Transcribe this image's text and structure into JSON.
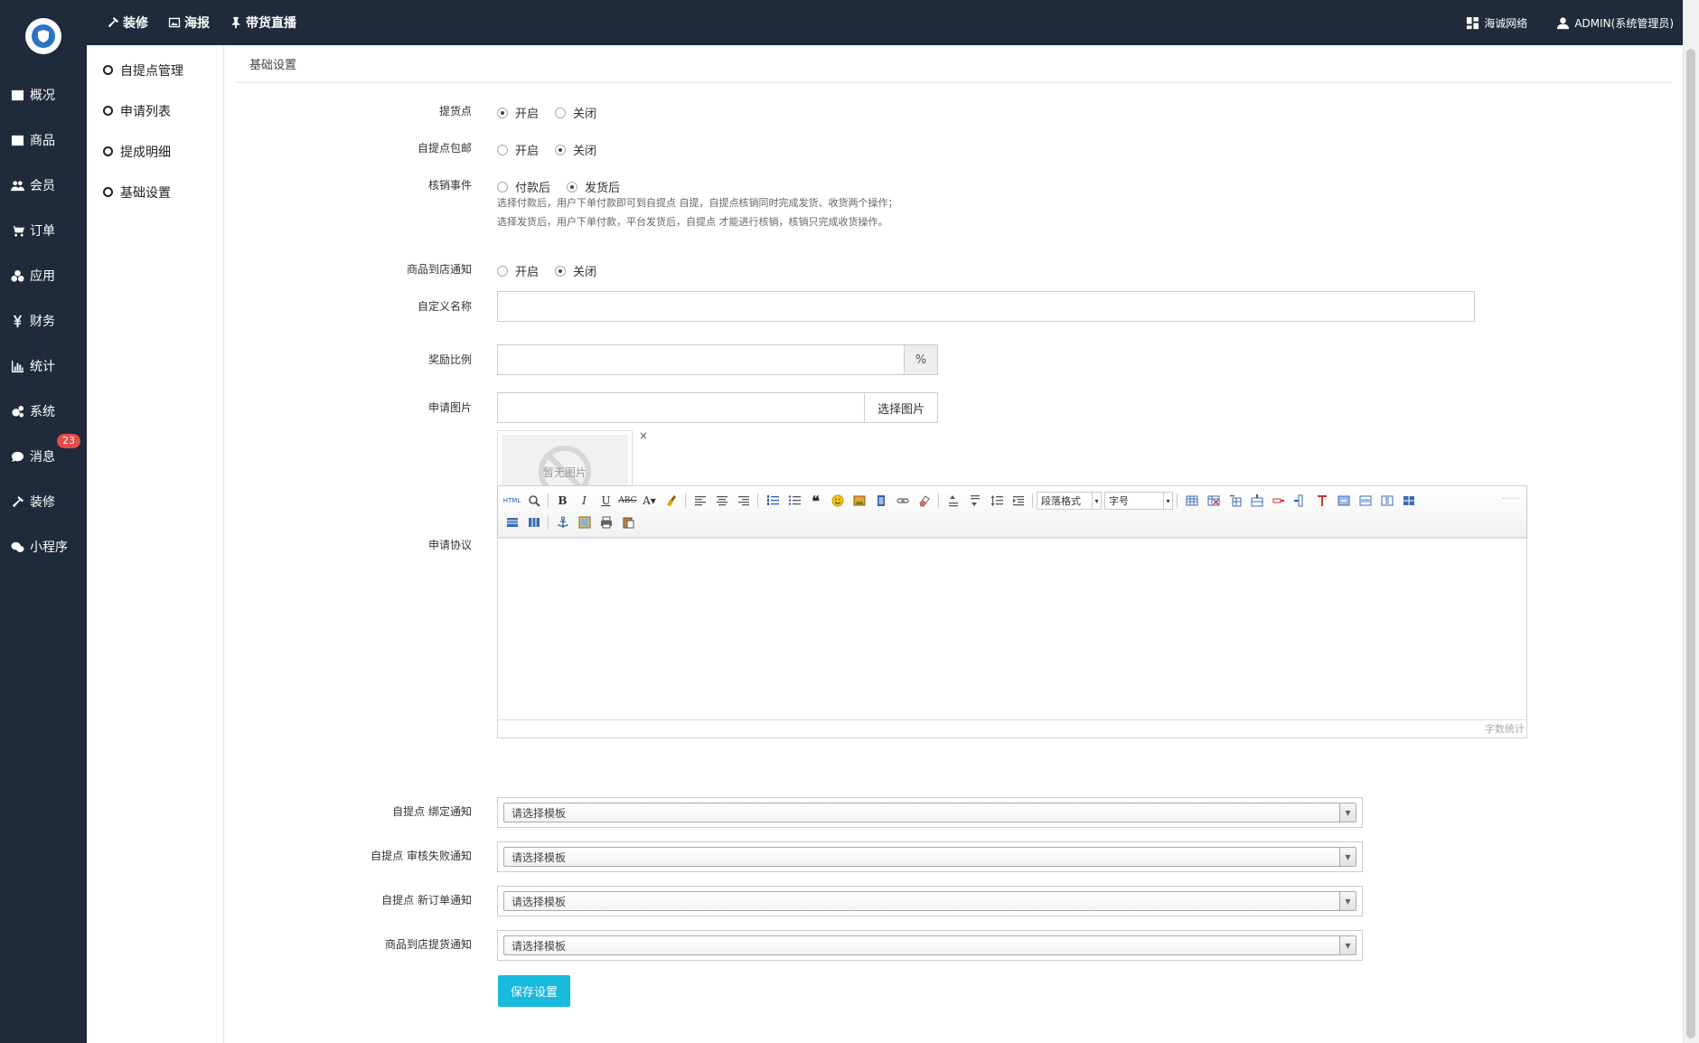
{
  "topnav": {
    "items": [
      {
        "label": "装修",
        "icon": "hammer-icon"
      },
      {
        "label": "海报",
        "icon": "image-icon"
      },
      {
        "label": "带货直播",
        "icon": "pin-icon"
      }
    ],
    "brand": "海诚网络",
    "user": "ADMIN(系统管理员)"
  },
  "sidebar": {
    "items": [
      {
        "label": "概况",
        "icon": "overview-icon"
      },
      {
        "label": "商品",
        "icon": "goods-icon"
      },
      {
        "label": "会员",
        "icon": "members-icon"
      },
      {
        "label": "订单",
        "icon": "cart-icon"
      },
      {
        "label": "应用",
        "icon": "apps-icon"
      },
      {
        "label": "财务",
        "icon": "yen-icon"
      },
      {
        "label": "统计",
        "icon": "chart-icon"
      },
      {
        "label": "系统",
        "icon": "gears-icon"
      },
      {
        "label": "消息",
        "icon": "chat-icon",
        "badge": "23"
      },
      {
        "label": "装修",
        "icon": "hammer-icon"
      },
      {
        "label": "小程序",
        "icon": "wechat-icon"
      }
    ]
  },
  "subnav": {
    "items": [
      "自提点管理",
      "申请列表",
      "提成明细",
      "基础设置"
    ]
  },
  "breadcrumb": "基础设置",
  "form": {
    "pickup": {
      "label": "提货点",
      "options": [
        "开启",
        "关闭"
      ],
      "selected": 0
    },
    "free_shipping": {
      "label": "自提点包邮",
      "options": [
        "开启",
        "关闭"
      ],
      "selected": 1
    },
    "verify_event": {
      "label": "核销事件",
      "options": [
        "付款后",
        "发货后"
      ],
      "selected": 1,
      "help1": "选择付款后，用户下单付款即可到自提点 自提，自提点核销同时完成发货、收货两个操作；",
      "help2": "选择发货后，用户下单付款，平台发货后，自提点 才能进行核销，核销只完成收货操作。"
    },
    "arrival_notice": {
      "label": "商品到店通知",
      "options": [
        "开启",
        "关闭"
      ],
      "selected": 1
    },
    "custom_name": {
      "label": "自定义名称",
      "value": ""
    },
    "reward_ratio": {
      "label": "奖励比例",
      "value": "",
      "unit": "%"
    },
    "apply_image": {
      "label": "申请图片",
      "value": "",
      "button": "选择图片",
      "placeholder_text": "暂无图片",
      "remove": "×"
    },
    "agreement": {
      "label": "申请协议",
      "paragraph_format": "段落格式",
      "font_size": "字号",
      "word_count": "字数统计",
      "html_btn": "HTML"
    },
    "notice_bind": {
      "label": "自提点 绑定通知",
      "value": "请选择模板"
    },
    "notice_fail": {
      "label": "自提点 审核失败通知",
      "value": "请选择模板"
    },
    "notice_order": {
      "label": "自提点 新订单通知",
      "value": "请选择模板"
    },
    "notice_arrival": {
      "label": "商品到店提货通知",
      "value": "请选择模板"
    },
    "save": "保存设置"
  },
  "colors": {
    "dark_nav": "#1f2a3a",
    "primary_button": "#17b9dc",
    "badge": "#e54b4b"
  }
}
